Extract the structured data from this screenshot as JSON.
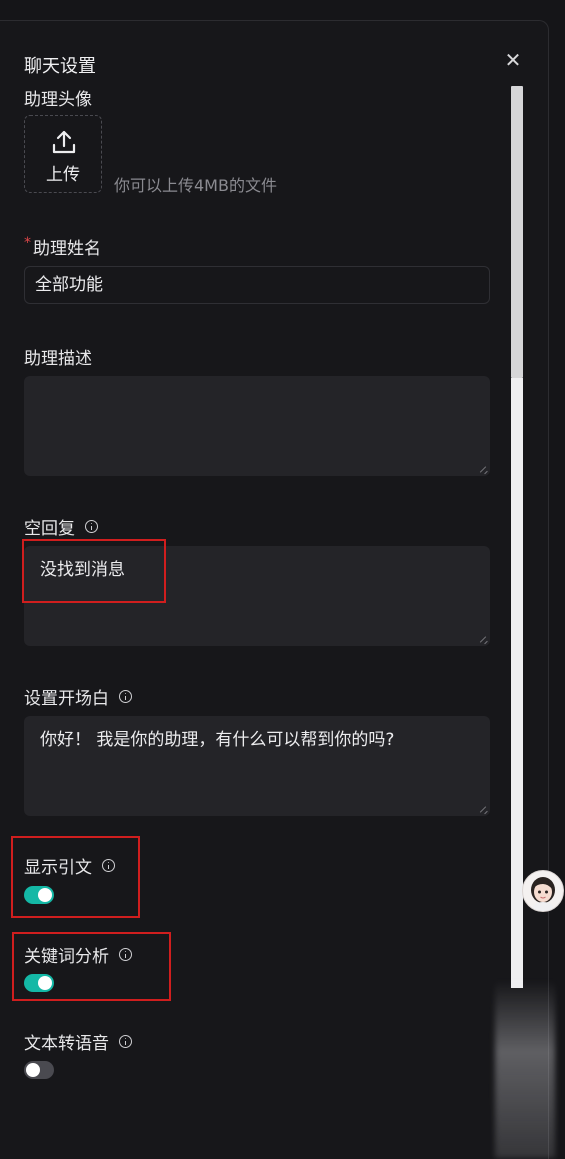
{
  "dialog": {
    "title": "聊天设置",
    "close_icon": "close-icon"
  },
  "avatar_section": {
    "label": "助理头像",
    "upload_label": "上传",
    "upload_icon": "upload-icon",
    "hint": "你可以上传4MB的文件"
  },
  "name_field": {
    "required_mark": "*",
    "label": "助理姓名",
    "value": "全部功能"
  },
  "description_field": {
    "label": "助理描述",
    "value": ""
  },
  "empty_reply_field": {
    "label": "空回复",
    "value": "没找到消息"
  },
  "opener_field": {
    "label": "设置开场白",
    "value": "你好！ 我是你的助理，有什么可以帮到你的吗?"
  },
  "toggles": [
    {
      "label": "显示引文",
      "on": true
    },
    {
      "label": "关键词分析",
      "on": true
    },
    {
      "label": "文本转语音",
      "on": false
    }
  ],
  "colors": {
    "accent_toggle": "#14b8a6",
    "highlight_box": "#d01e1e",
    "background": "#17171a"
  }
}
